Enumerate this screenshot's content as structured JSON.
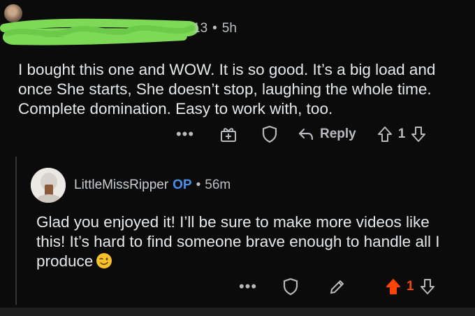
{
  "top_comment": {
    "meta_suffix": "13",
    "separator": "•",
    "time": "5h",
    "body": "I bought this one and WOW. It is so good. It’s a big load and once She starts, She doesn’t stop, laughing the whole time. Complete domination. Easy to work with, too.",
    "actions": {
      "more": "•••",
      "reply_label": "Reply",
      "score": "1"
    }
  },
  "reply_comment": {
    "username": "LittleMissRipper",
    "op_badge": "OP",
    "separator": "•",
    "time": "56m",
    "body": "Glad you enjoyed it! I’ll be sure to make more videos like this! It’s hard to find someone brave enough to handle all I produce",
    "actions": {
      "more": "•••",
      "score": "1"
    }
  },
  "colors": {
    "background": "#0b0b0b",
    "text": "#e6e8ea",
    "muted": "#b8bbbe",
    "op_blue": "#4a8fe7",
    "upvote_active": "#ff4500",
    "redaction_green": "#7ed957"
  }
}
